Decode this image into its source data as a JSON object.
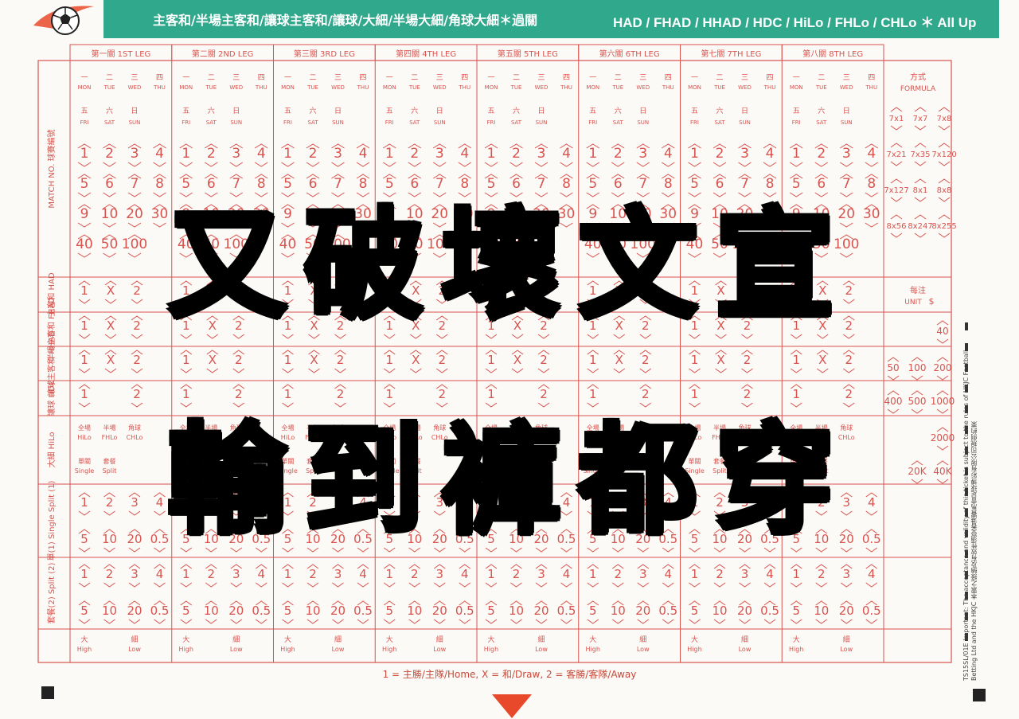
{
  "banner": {
    "left_text": "主客和/半場主客和/讓球主客和/讓球/大細/半場大細/角球大細＊過關",
    "right_text": "HAD / FHAD / HHAD / HDC / HiLo / FHLo / CHLo ＊ All Up",
    "color": "#2fa88c"
  },
  "legs": [
    {
      "zh": "第一關",
      "en": "1ST LEG"
    },
    {
      "zh": "第二關",
      "en": "2ND LEG"
    },
    {
      "zh": "第三關",
      "en": "3RD LEG"
    },
    {
      "zh": "第四關",
      "en": "4TH LEG"
    },
    {
      "zh": "第五關",
      "en": "5TH LEG"
    },
    {
      "zh": "第六關",
      "en": "6TH LEG"
    },
    {
      "zh": "第七關",
      "en": "7TH LEG"
    },
    {
      "zh": "第八關",
      "en": "8TH LEG"
    }
  ],
  "days_row1": [
    {
      "zh": "一",
      "en": "MON"
    },
    {
      "zh": "二",
      "en": "TUE"
    },
    {
      "zh": "三",
      "en": "WED"
    },
    {
      "zh": "四",
      "en": "THU"
    }
  ],
  "days_row2": [
    {
      "zh": "五",
      "en": "FRI"
    },
    {
      "zh": "六",
      "en": "SAT"
    },
    {
      "zh": "日",
      "en": "SUN"
    }
  ],
  "match_numbers": [
    [
      "1",
      "2",
      "3",
      "4"
    ],
    [
      "5",
      "6",
      "7",
      "8"
    ],
    [
      "9",
      "10",
      "20",
      "30"
    ],
    [
      "40",
      "50",
      "100"
    ]
  ],
  "row_labels": {
    "match_no": "MATCH NO.",
    "match_no_zh": "球賽編號",
    "had": "主客和 HAD",
    "fhad": "半場主客和 FHAD",
    "hhad": "讓球主客和 HHAD",
    "hdc": "讓球 HDC",
    "hilo": "大細 HiLo",
    "single": "單(1) Single Split (1)",
    "split2": "套餐(2) Split (2)"
  },
  "had_options": [
    "1",
    "X",
    "2"
  ],
  "hdc_options": [
    "1",
    "2"
  ],
  "hilo_types": [
    {
      "zh": "全場",
      "en": "HiLo"
    },
    {
      "zh": "半場",
      "en": "FHLo"
    },
    {
      "zh": "角球",
      "en": "CHLo"
    }
  ],
  "hilo_sub": [
    {
      "zh": "單關",
      "en": "Single"
    },
    {
      "zh": "套餐",
      "en": "Split"
    }
  ],
  "split_row1": [
    "1",
    "2",
    "3",
    "4"
  ],
  "split_row2": [
    "5",
    "10",
    "20",
    "0.5"
  ],
  "high_low": [
    {
      "zh": "大",
      "en": "High"
    },
    {
      "zh": "細",
      "en": "Low"
    }
  ],
  "formula": {
    "title_zh": "方式",
    "title_en": "FORMULA",
    "options": [
      "7x1",
      "7x7",
      "7x8",
      "7x21",
      "7x35",
      "7x120",
      "7x127",
      "8x1",
      "8x8",
      "8x56",
      "8x247",
      "8x255"
    ]
  },
  "unit": {
    "title_zh": "每注",
    "title_en": "UNIT",
    "symbol": "$",
    "values": [
      "40",
      "50",
      "100",
      "200",
      "400",
      "500",
      "1000",
      "2000",
      "20K",
      "40K"
    ]
  },
  "footer_note": "1 = 主勝/主隊/Home, X = 和/Draw, 2 = 客勝/客隊/Away",
  "form_code": "TS15SL/01E",
  "disclaimer": "Important: The acceptance and validity of this ticket is subject to the rules of HKJC Football Betting Ltd and the HKJC 本票之接納及有效性須受香港賽馬會足球博彩有限公司規例約束",
  "caption": {
    "line1": "又破壞文宣",
    "line2": "輸到褲都穿"
  },
  "colors": {
    "grid_red": "#d9534f",
    "banner": "#2fa88c",
    "arrow": "#e9492b",
    "caption": "#000000"
  }
}
